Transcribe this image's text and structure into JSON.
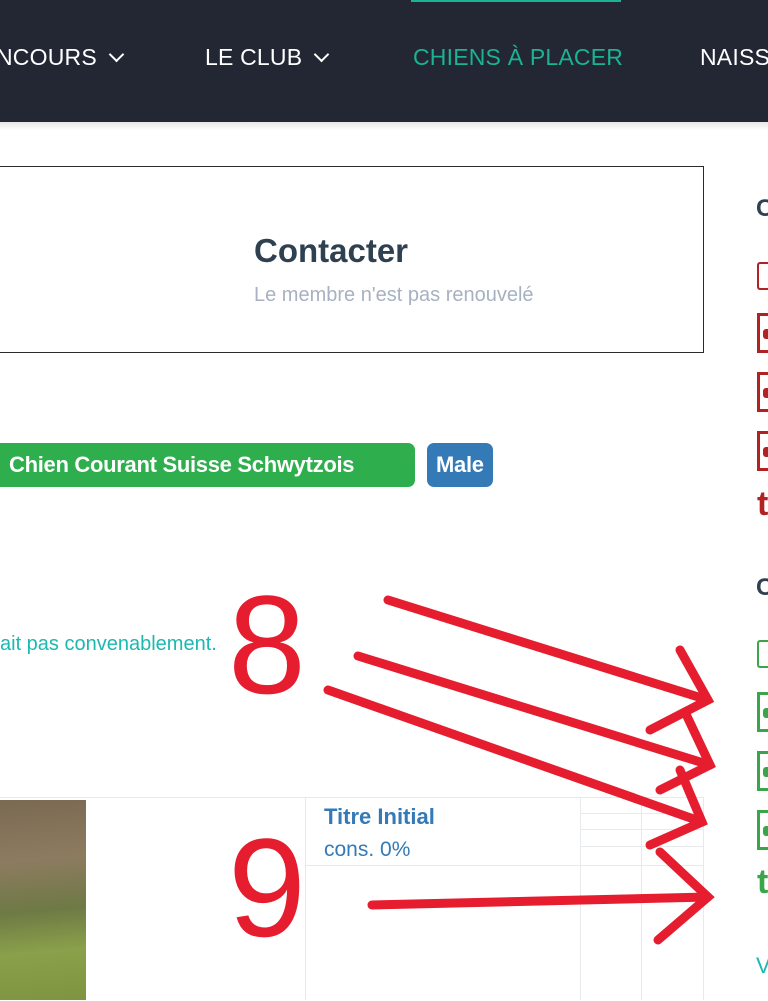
{
  "nav": {
    "items": [
      {
        "label": "NCOURS",
        "has_dropdown": true
      },
      {
        "label": "LE CLUB",
        "has_dropdown": true
      },
      {
        "label": "CHIENS À PLACER",
        "active": true
      },
      {
        "label": "NAISS"
      }
    ],
    "accent_color": "#1ab394",
    "background": "#222733"
  },
  "contact": {
    "title": "Contacter",
    "subtitle": "Le membre n'est pas renouvelé"
  },
  "badges": {
    "breed": "Chien Courant Suisse Schwytzois",
    "sex": "Male"
  },
  "partial_text": "ait pas convenablement.",
  "table": {
    "title_label": "Titre Initial",
    "title_value": "cons. 0%"
  },
  "sidebar": {
    "heading_1": "C",
    "heading_2": "C",
    "link": "V",
    "colors": {
      "red": "#b22222",
      "green": "#3aa54a"
    }
  },
  "annotation": {
    "number_1": "8",
    "number_2": "9",
    "color": "#e51d2e"
  }
}
